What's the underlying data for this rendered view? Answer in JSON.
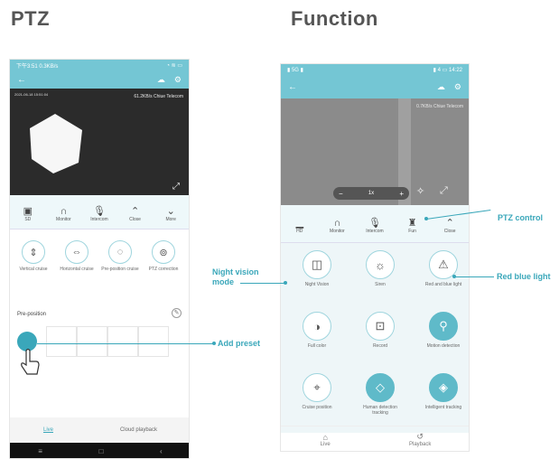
{
  "headings": {
    "left": "PTZ",
    "right": "Function"
  },
  "left_phone": {
    "status_left": "下午3:51 0.3KB/s",
    "status_right": "◔ ≋ ▭",
    "back_icon": "back-arrow-icon",
    "speed_text": "61.2KB/s  Chiue Telecom",
    "timestamp": "2021-06-18 15:51:04",
    "toolbar": [
      {
        "label": "SD",
        "icon": "▣"
      },
      {
        "label": "Monitor",
        "icon": "∩"
      },
      {
        "label": "Intercom",
        "icon": "🎙"
      },
      {
        "label": "Close",
        "icon": "⌃"
      },
      {
        "label": "More",
        "icon": "⌄"
      }
    ],
    "ptz_buttons": [
      {
        "label": "Vertical cruise",
        "icon": "⇕"
      },
      {
        "label": "Horizontal cruise",
        "icon": "⇔"
      },
      {
        "label": "Pre-position cruise",
        "icon": "◌"
      },
      {
        "label": "PTZ correction",
        "icon": "⊚"
      }
    ],
    "preposition_title": "Pre-position",
    "bottom_tabs": [
      "Live",
      "Cloud playback"
    ],
    "nav": [
      "≡",
      "□",
      "‹"
    ]
  },
  "right_phone": {
    "status_left": "▮ 5G ▮",
    "status_right": "▮ 4 ▭ 14:22",
    "speed_text": "0.7KB/s  Chiue Telecom",
    "zoom_text": "1x",
    "toolbar": [
      {
        "label": "HD",
        "icon": "▁"
      },
      {
        "label": "Monitor",
        "icon": "∩"
      },
      {
        "label": "Intercom",
        "icon": "🎙"
      },
      {
        "label": "Fun",
        "icon": "♜"
      },
      {
        "label": "Close",
        "icon": "⌃"
      }
    ],
    "functions": [
      {
        "label": "Night Vision",
        "icon": "◫",
        "filled": false
      },
      {
        "label": "Siren",
        "icon": "☼",
        "filled": false
      },
      {
        "label": "Red and blue light",
        "icon": "⚠",
        "filled": false
      },
      {
        "label": "Full color",
        "icon": "◑",
        "filled": false
      },
      {
        "label": "Record",
        "icon": "⊡",
        "filled": false
      },
      {
        "label": "Motion detection",
        "icon": "⚲",
        "filled": true
      },
      {
        "label": "Cruise position",
        "icon": "⌖",
        "filled": false
      },
      {
        "label": "Human detection tracking",
        "icon": "◇",
        "filled": true
      },
      {
        "label": "Intelligent tracking",
        "icon": "◈",
        "filled": true
      }
    ],
    "bottom_tabs": [
      "Live",
      "Playback"
    ]
  },
  "callouts": {
    "ptz_control": "PTZ control",
    "night_vision": "Night vision mode",
    "red_blue": "Red blue light",
    "add_preset": "Add preset"
  }
}
